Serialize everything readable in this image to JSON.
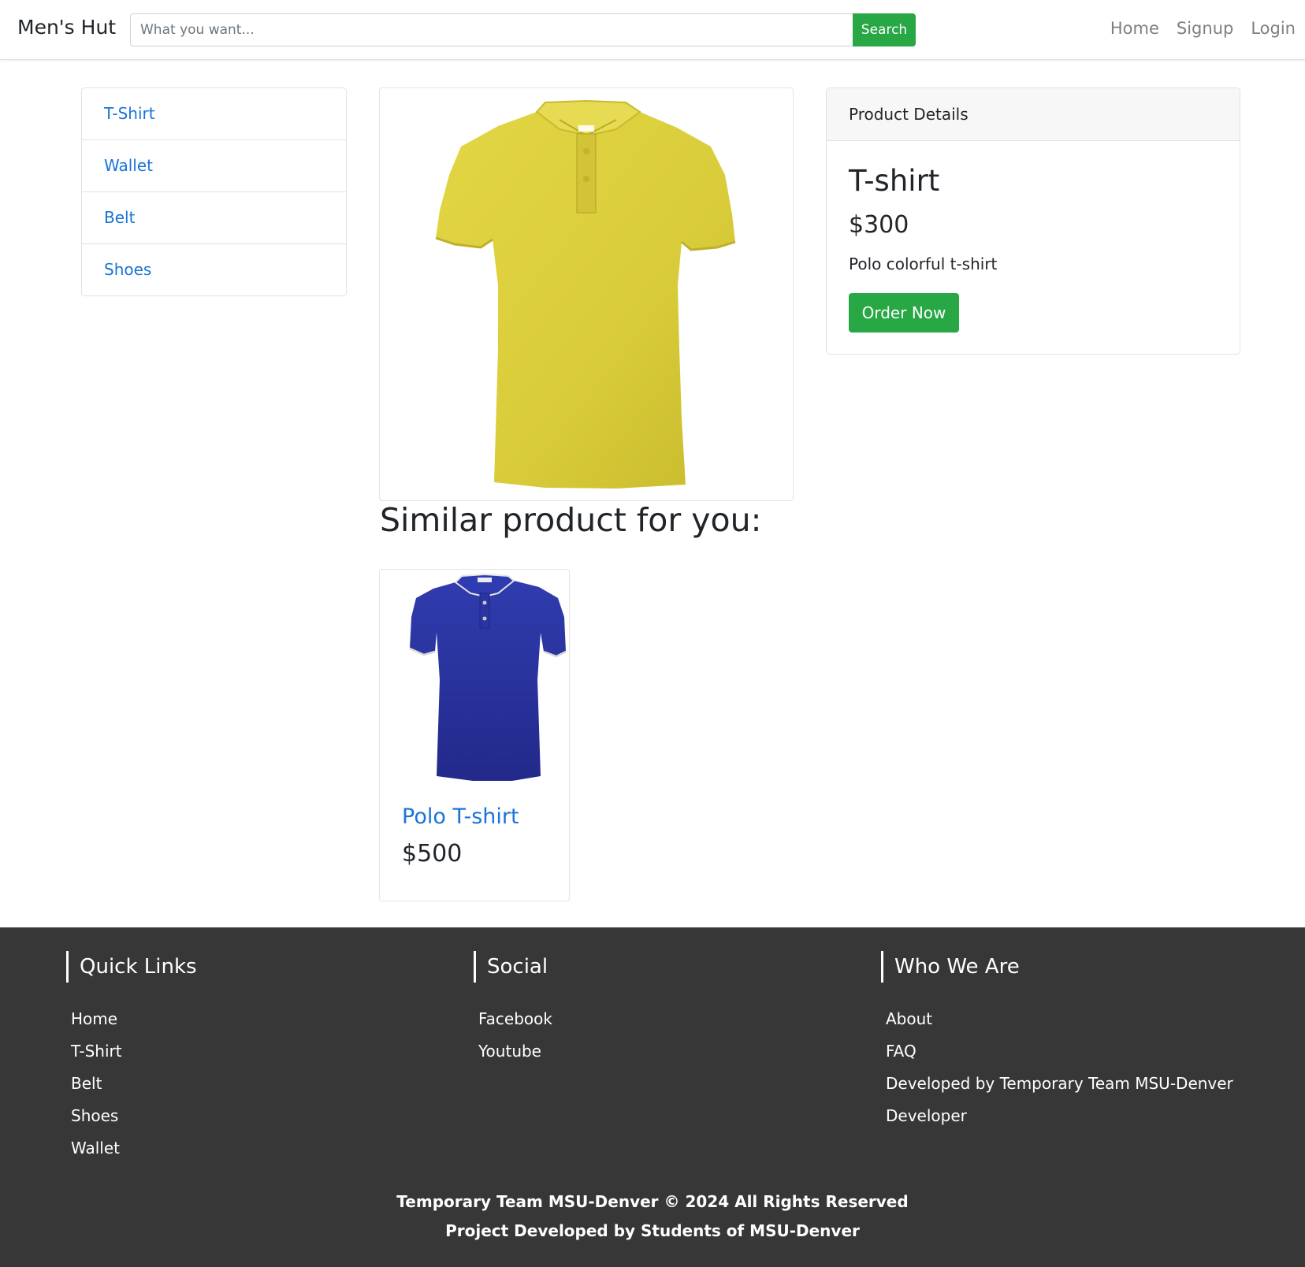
{
  "navbar": {
    "brand": "Men's Hut",
    "search_placeholder": "What you want...",
    "search_button": "Search",
    "links": [
      "Home",
      "Signup",
      "Login"
    ]
  },
  "categories": [
    "T-Shirt",
    "Wallet",
    "Belt",
    "Shoes"
  ],
  "product": {
    "image_icon": "yellow-polo-shirt",
    "image_color": "#d9cc3a",
    "details_header": "Product Details",
    "title": "T-shirt",
    "price": "$300",
    "description": "Polo colorful t-shirt",
    "order_button": "Order Now"
  },
  "similar": {
    "heading": "Similar product for you:",
    "items": [
      {
        "name": "Polo T-shirt",
        "price": "$500",
        "image_icon": "blue-polo-shirt",
        "image_color": "#2a35a3"
      }
    ]
  },
  "footer": {
    "columns": [
      {
        "heading": "Quick Links",
        "links": [
          "Home",
          "T-Shirt",
          "Belt",
          "Shoes",
          "Wallet"
        ]
      },
      {
        "heading": "Social",
        "links": [
          "Facebook",
          "Youtube"
        ]
      },
      {
        "heading": "Who We Are",
        "links": [
          "About",
          "FAQ",
          "Developed by Temporary Team MSU-Denver",
          "Developer"
        ]
      }
    ],
    "copyright": "Temporary Team MSU-Denver © 2024 All Rights Reserved",
    "credit": "Project Developed by Students of MSU-Denver"
  },
  "colors": {
    "accent_green": "#28a745",
    "link_blue": "#1a73d9",
    "footer_bg": "#373737"
  }
}
